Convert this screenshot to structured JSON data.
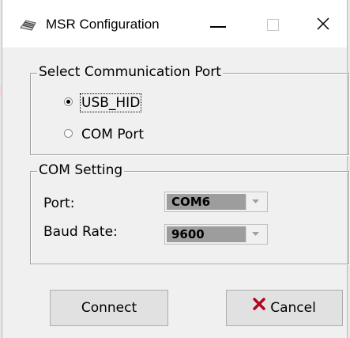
{
  "window": {
    "title": "MSR Configuration",
    "minimize_glyph": "minimize-icon",
    "maximize_glyph": "maximize-icon",
    "close_glyph": "close-icon"
  },
  "port_group": {
    "legend": "Select Communication Port",
    "options": [
      {
        "label": "USB_HID",
        "selected": true
      },
      {
        "label": "COM Port",
        "selected": false
      }
    ]
  },
  "com_group": {
    "legend": "COM Setting",
    "port_label": "Port:",
    "port_value": "COM6",
    "baud_label": "Baud Rate:",
    "baud_value": "9600"
  },
  "buttons": {
    "connect": "Connect",
    "cancel": "Cancel"
  },
  "colors": {
    "window_bg": "#f0f0f0",
    "titlebar_bg": "#ffffff",
    "cancel_icon": "#b3001b",
    "combo_value_bg": "#9d9d9d"
  }
}
